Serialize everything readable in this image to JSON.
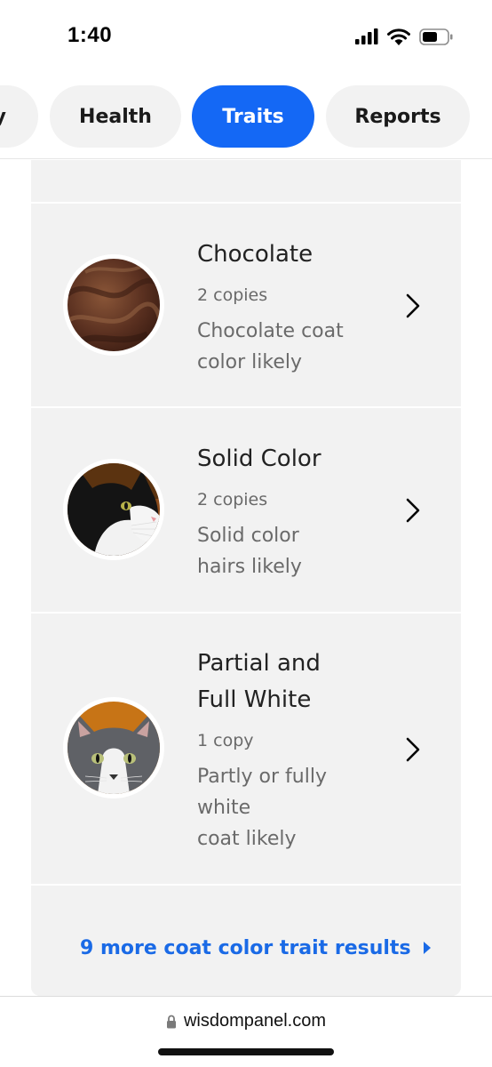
{
  "status_bar": {
    "time": "1:40",
    "icons": [
      "signal-icon",
      "wifi-icon",
      "battery-icon"
    ]
  },
  "tabs": [
    {
      "label": "y",
      "active": false
    },
    {
      "label": "Health",
      "active": false
    },
    {
      "label": "Traits",
      "active": true
    },
    {
      "label": "Reports",
      "active": false
    }
  ],
  "traits": [
    {
      "title": "Chocolate",
      "copies": "2 copies",
      "description_lines": [
        "Chocolate coat",
        "color likely"
      ],
      "image": "chocolate-fur-photo"
    },
    {
      "title": "Solid Color",
      "copies": "2 copies",
      "description_lines": [
        "Solid color",
        "hairs likely"
      ],
      "image": "tuxedo-cat-photo"
    },
    {
      "title_lines": [
        "Partial and",
        "Full White"
      ],
      "copies": "1 copy",
      "description_lines": [
        "Partly or fully",
        "white",
        "coat likely"
      ],
      "image": "gray-white-cat-photo"
    }
  ],
  "more_link": {
    "label": "9 more coat color trait results",
    "icon": "triangle-right-icon"
  },
  "browser": {
    "url": "wisdompanel.com",
    "icon": "lock-icon"
  },
  "colors": {
    "accent": "#1468f5",
    "link": "#1a6ae6",
    "card_bg": "#f2f2f2"
  }
}
